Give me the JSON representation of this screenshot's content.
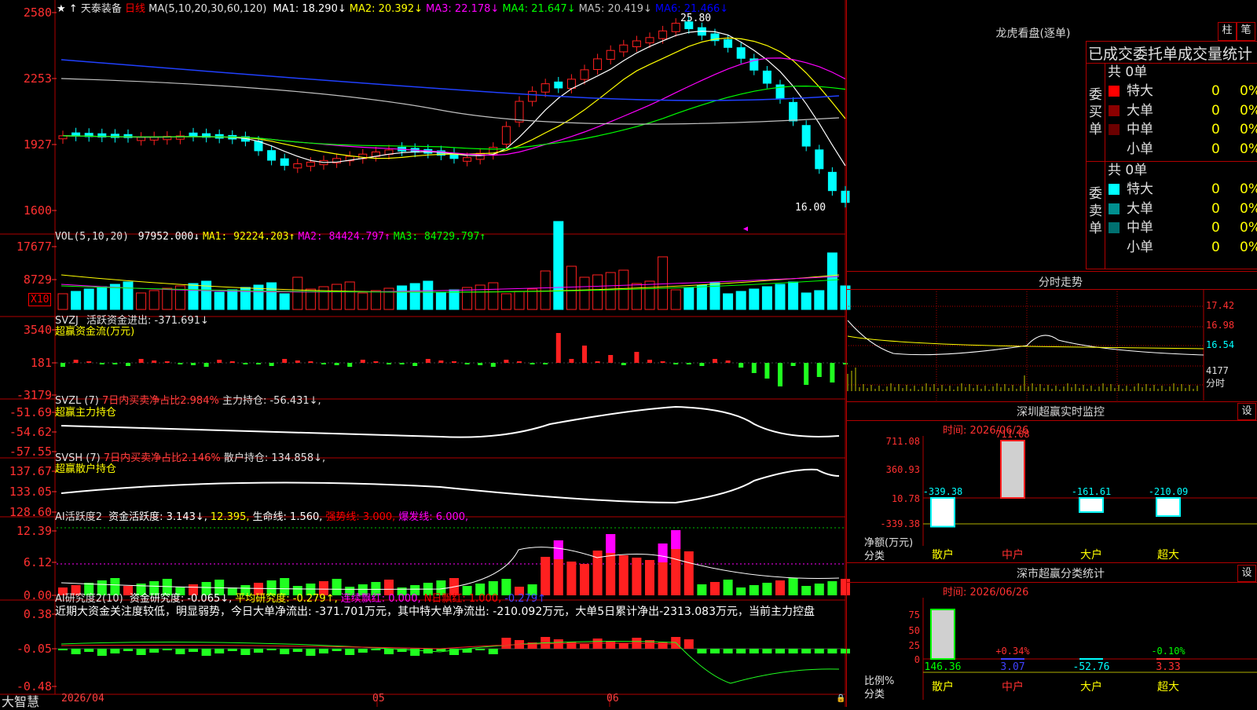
{
  "stock": {
    "name": "天泰装备",
    "period": "日线"
  },
  "main_chart": {
    "y_ticks": [
      "2580",
      "2253",
      "1927",
      "1600"
    ],
    "ma_legend": "MA(5,10,20,30,60,120)",
    "ma_items": [
      {
        "label": "MA1: 18.290↓",
        "color": "#ffffff"
      },
      {
        "label": "MA2: 20.392↓",
        "color": "#ffff00"
      },
      {
        "label": "MA3: 22.178↓",
        "color": "#ff00ff"
      },
      {
        "label": "MA4: 21.647↓",
        "color": "#00ff00"
      },
      {
        "label": "MA5: 20.419↓",
        "color": "#c0c0c0"
      },
      {
        "label": "MA6: 21.466↓",
        "color": "#0000ff"
      }
    ],
    "high_label": "25.80",
    "low_label": "16.00"
  },
  "vol_panel": {
    "y_ticks": [
      "17677",
      "8729"
    ],
    "unit": "X10",
    "legend": "VOL(5,10,20)",
    "items": [
      {
        "label": "97952.000↓",
        "color": "#ffffff"
      },
      {
        "label": "MA1: 92224.203↑",
        "color": "#ffff00"
      },
      {
        "label": "MA2: 84424.797↑",
        "color": "#ff00ff"
      },
      {
        "label": "MA3: 84729.797↑",
        "color": "#00ff00"
      }
    ]
  },
  "svzj_panel": {
    "y_ticks": [
      "3540",
      "181",
      "-3179"
    ],
    "legend": "SVZJ",
    "item": "活跃资金进出: -371.691↓",
    "subtitle": "超赢资金流(万元)"
  },
  "svzl_panel": {
    "y_ticks": [
      "-51.69",
      "-54.62",
      "-57.55"
    ],
    "legend": "SVZL (7)",
    "ratio": "7日内买卖净占比2.984%",
    "item": "主力持仓: -56.431↓,",
    "subtitle": "超赢主力持仓"
  },
  "svsh_panel": {
    "y_ticks": [
      "137.67",
      "133.05",
      "128.60"
    ],
    "legend": "SVSH (7)",
    "ratio": "7日内买卖净占比2.146%",
    "item": "散户持仓: 134.858↓,",
    "subtitle": "超赢散户持仓"
  },
  "ai_active_panel": {
    "y_ticks": [
      "12.39",
      "6.12",
      "0.00"
    ],
    "legend": "AI活跃度2",
    "items": [
      {
        "label": "资金活跃度: 3.143↓,",
        "color": "#ffffff"
      },
      {
        "label": "12.395,",
        "color": "#ffff00"
      },
      {
        "label": "生命线: 1.560,",
        "color": "#ffffff"
      },
      {
        "label": "强势线: 3.000,",
        "color": "#ff0000"
      },
      {
        "label": "爆发线: 6.000,",
        "color": "#ff00ff"
      }
    ]
  },
  "ai_research_panel": {
    "y_ticks": [
      "0.38",
      "-0.05",
      "-0.48"
    ],
    "legend": "AI研究度2(10)",
    "items": [
      {
        "label": "资金研究度: -0.065↓,",
        "color": "#ffffff"
      },
      {
        "label": "平均研究度: -0.279↑,",
        "color": "#ffff00"
      },
      {
        "label": "连续飘红: 0.000,",
        "color": "#ff00ff"
      },
      {
        "label": "N日飘红: 1.000,",
        "color": "#ff0000"
      },
      {
        "label": "-0.279↑",
        "color": "#4040ff"
      }
    ],
    "commentary": "近期大资金关注度较低，明显弱势，今日大单净流出: -371.701万元，其中特大单净流出: -210.092万元，大单5日累计净出-2313.083万元，当前主力控盘"
  },
  "bottom_axis": {
    "brand": "大智慧",
    "dates": [
      "2026/04",
      "05",
      "06"
    ]
  },
  "dragon_tiger": {
    "title": "龙虎看盘(逐单)",
    "btn_bar": "柱",
    "btn_trade": "笔",
    "header": "已成交委托单成交量统计",
    "buy_label": "委买单",
    "sell_label": "委卖单",
    "buy_total": "共 0单",
    "sell_total": "共 0单",
    "buy_rows": [
      {
        "name": "特大",
        "count": "0",
        "pct": "0%",
        "color": "#ff0000"
      },
      {
        "name": "大单",
        "count": "0",
        "pct": "0%",
        "color": "#8b0000"
      },
      {
        "name": "中单",
        "count": "0",
        "pct": "0%",
        "color": "#6b0000"
      },
      {
        "name": "小单",
        "count": "0",
        "pct": "0%",
        "color": ""
      }
    ],
    "sell_rows": [
      {
        "name": "特大",
        "count": "0",
        "pct": "0%",
        "color": "#00ffff"
      },
      {
        "name": "大单",
        "count": "0",
        "pct": "0%",
        "color": "#009090"
      },
      {
        "name": "中单",
        "count": "0",
        "pct": "0%",
        "color": "#007070"
      },
      {
        "name": "小单",
        "count": "0",
        "pct": "0%",
        "color": ""
      }
    ]
  },
  "intraday": {
    "title": "分时走势",
    "y_ticks": [
      "17.42",
      "16.98",
      "16.54"
    ],
    "vol_tick": "4177",
    "vol_label": "分时"
  },
  "shenzhen_monitor": {
    "title": "深圳超赢实时监控",
    "settings_btn": "设",
    "time_label": "时间: 2026/06/26",
    "y_ticks": [
      "711.08",
      "360.93",
      "10.78",
      "-339.38"
    ],
    "y_caption_1": "净额(万元)",
    "y_caption_2": "分类",
    "chart_data": {
      "type": "bar",
      "categories": [
        "散户",
        "中户",
        "大户",
        "超大"
      ],
      "values": [
        -339.38,
        711.08,
        -161.61,
        -210.09
      ],
      "value_labels": [
        "-339.38",
        "711.08",
        "-161.61",
        "-210.09"
      ],
      "ylim": [
        -339.38,
        711.08
      ]
    }
  },
  "shenzhen_class": {
    "title": "深市超赢分类统计",
    "settings_btn": "设",
    "time_label": "时间: 2026/06/26",
    "y_ticks": [
      "75",
      "50",
      "25",
      "0"
    ],
    "y_caption_1": "比例%",
    "y_caption_2": "分类",
    "chart_data": {
      "type": "bar",
      "categories": [
        "散户",
        "中户",
        "大户",
        "超大"
      ],
      "ratio_labels": [
        "",
        "+0.34%",
        "",
        "-0.10%"
      ],
      "values": [
        146.36,
        3.07,
        -52.76,
        3.33
      ],
      "value_labels": [
        "146.36",
        "3.07",
        "-52.76",
        "3.33"
      ],
      "ylim": [
        0,
        100
      ]
    }
  }
}
